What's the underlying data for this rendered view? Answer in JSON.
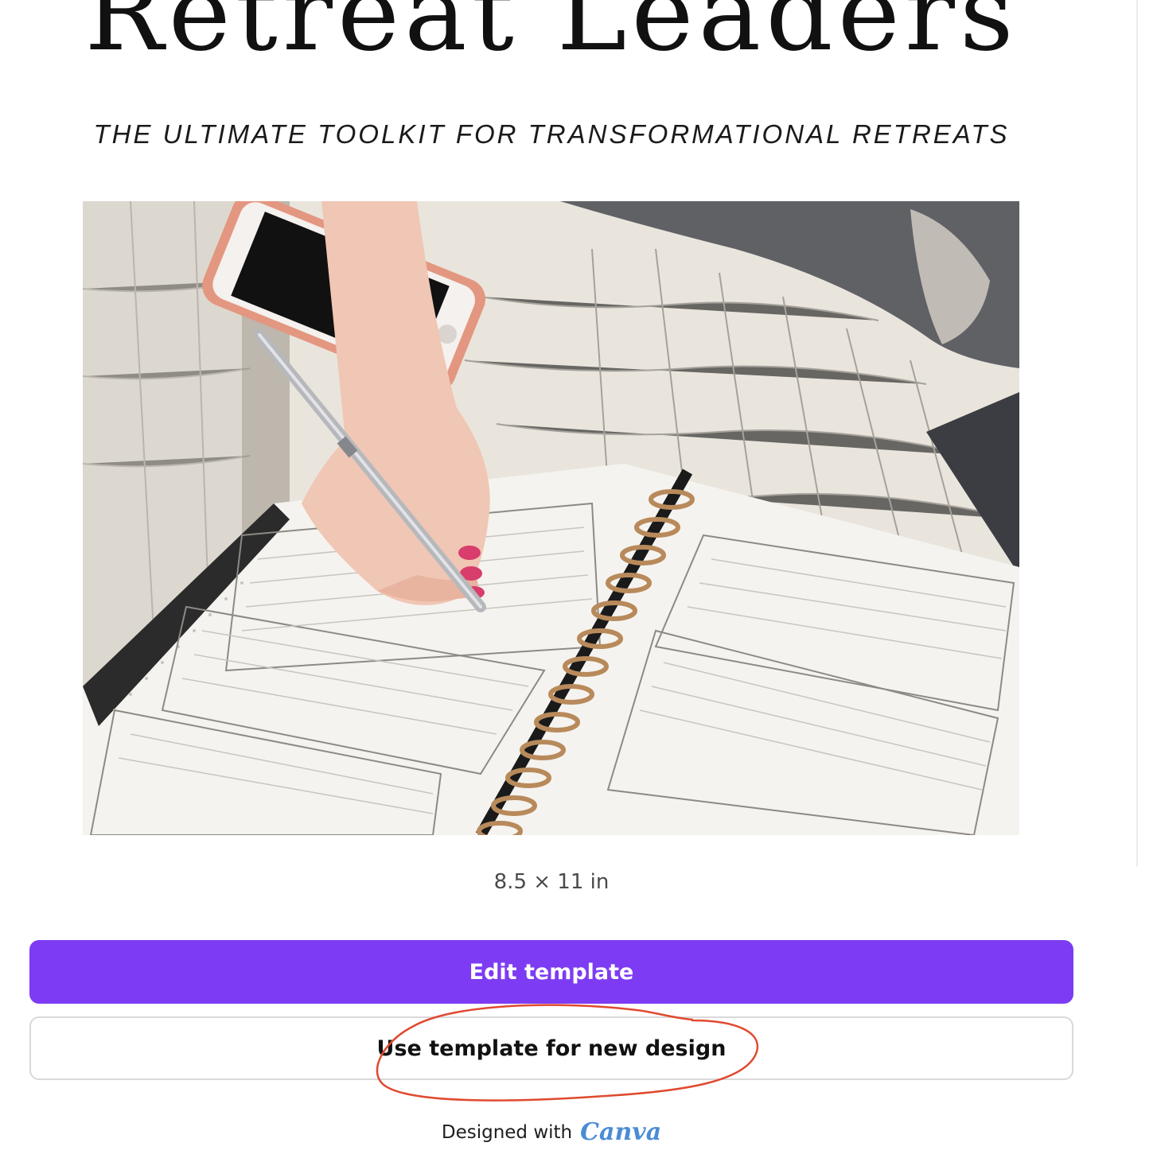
{
  "header": {
    "title": "Retreat Leaders",
    "subtitle": "THE ULTIMATE TOOLKIT FOR TRANSFORMATIONAL RETREATS"
  },
  "preview": {
    "image_description_icon": "photo-image-icon",
    "dimensions": "8.5 × 11 in"
  },
  "actions": {
    "edit_label": "Edit template",
    "use_label": "Use template for new design"
  },
  "footer": {
    "designed_with": "Designed with",
    "brand": "Canva"
  },
  "colors": {
    "primary": "#7d3cf3",
    "annotation": "#e0492f",
    "brand": "#4a8cd4"
  }
}
